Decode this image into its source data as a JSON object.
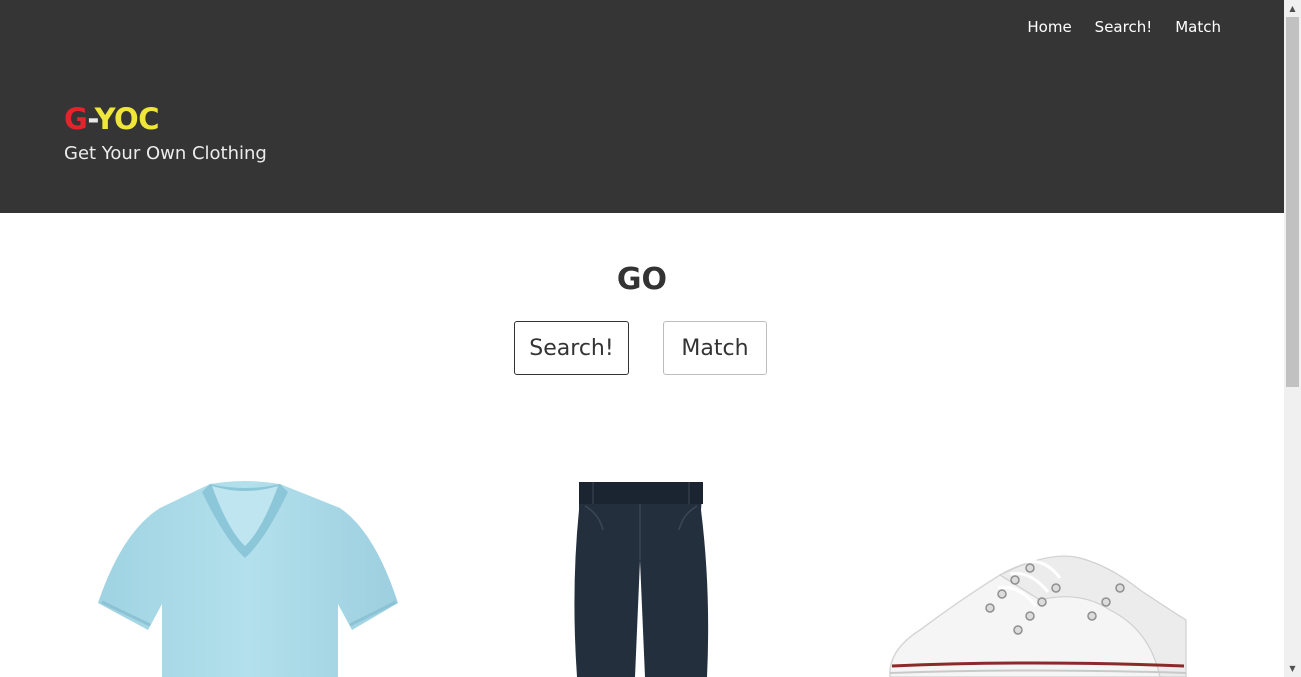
{
  "nav": {
    "home": "Home",
    "search": "Search!",
    "match": "Match"
  },
  "brand": {
    "g": "G",
    "dash": "-",
    "yoc": "YOC",
    "tagline": "Get Your Own Clothing",
    "colors": {
      "g": "#e3252b",
      "yoc": "#f0e63a",
      "header_bg": "#353535"
    }
  },
  "main": {
    "heading": "GO",
    "search_button": "Search!",
    "match_button": "Match"
  },
  "products": [
    {
      "name": "tshirt-icon",
      "color": "#a9dbe8"
    },
    {
      "name": "pants-icon",
      "color": "#243040"
    },
    {
      "name": "sneakers-icon",
      "color": "#f6f6f6"
    }
  ],
  "scrollbar": {
    "up": "▲",
    "down": "▼"
  }
}
